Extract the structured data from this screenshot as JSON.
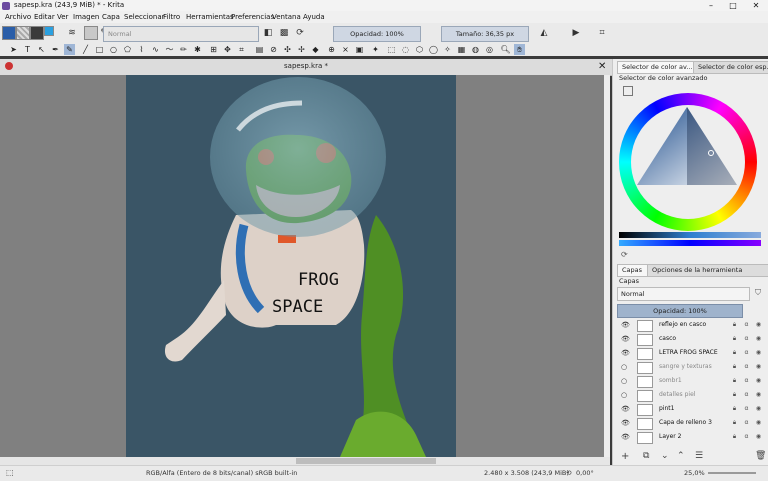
{
  "window": {
    "title": "sapesp.kra (243,9 MiB) * - Krita",
    "controls": [
      "–",
      "□",
      "✕"
    ]
  },
  "menu": [
    "Archivo",
    "Editar",
    "Ver",
    "Imagen",
    "Capa",
    "Seleccionar",
    "Filtro",
    "Herramientas",
    "Preferencias",
    "Ventana",
    "Ayuda"
  ],
  "toolbar": {
    "blend_mode": "Normal",
    "opacity": "Opacidad: 100%",
    "size": "Tamaño: 36,35 px"
  },
  "document": {
    "tab_title": "sapesp.kra *"
  },
  "canvas_text": {
    "line1": "FROG",
    "line2": "SPACE"
  },
  "dock": {
    "tab_color_1": "Selector de color av...",
    "tab_color_2": "Selector de color esp...",
    "color_header": "Selector de color avanzado",
    "tab_layers": "Capas",
    "tab_tool_options": "Opciones de la herramienta",
    "layers_header": "Capas",
    "layer_blend": "Normal",
    "layer_opacity": "Opacidad: 100%"
  },
  "layers": [
    {
      "name": "reflejo en casco",
      "visible": true,
      "selected": false
    },
    {
      "name": "casco",
      "visible": true,
      "selected": false
    },
    {
      "name": "LETRA FROG SPACE",
      "visible": true,
      "selected": false
    },
    {
      "name": "sangre y texturas",
      "visible": false,
      "selected": false
    },
    {
      "name": "sombr1",
      "visible": false,
      "selected": false
    },
    {
      "name": "detalles piel",
      "visible": false,
      "selected": false
    },
    {
      "name": "pint1",
      "visible": true,
      "selected": false
    },
    {
      "name": "Capa de relleno 3",
      "visible": true,
      "selected": false
    },
    {
      "name": "Layer 2",
      "visible": true,
      "selected": false
    }
  ],
  "status": {
    "color_space": "RGB/Alfa (Entero de 8 bits/canal)  sRGB built-in",
    "dimensions": "2.480 x 3.508 (243,9 MiB)",
    "rotation": "0,00°",
    "zoom": "25,0%"
  },
  "colors": {
    "canvas_bg": "#3a5566",
    "frog_green": "#5aa028",
    "selection_blue": "#cfd7e3"
  }
}
